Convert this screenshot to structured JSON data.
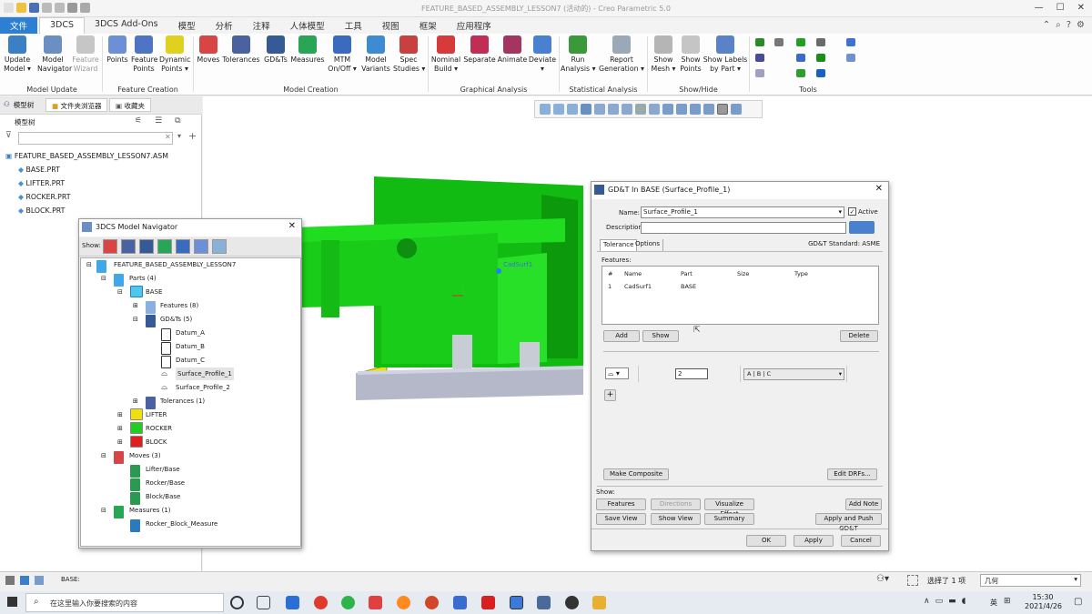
{
  "window": {
    "title": "FEATURE_BASED_ASSEMBLY_LESSON7 (活动的) - Creo Parametric 5.0"
  },
  "tabs": [
    "文件",
    "3DCS",
    "3DCS Add-Ons",
    "模型",
    "分析",
    "注释",
    "人体模型",
    "工具",
    "视图",
    "框架",
    "应用程序"
  ],
  "ribbon": {
    "update_model": "Update\nModel ▾",
    "model_navigator": "Model\nNavigator",
    "feature_wizard": "Feature\nWizard",
    "points": "Points",
    "feature_points": "Feature\nPoints",
    "dynamic_points": "Dynamic\nPoints ▾",
    "moves": "Moves",
    "tolerances": "Tolerances",
    "gdts": "GD&Ts",
    "measures": "Measures",
    "mtm": "MTM\nOn/Off ▾",
    "model_variants": "Model\nVariants",
    "spec_studies": "Spec\nStudies ▾",
    "nominal_build": "Nominal\nBuild ▾",
    "separate": "Separate",
    "animate": "Animate",
    "deviate": "Deviate\n▾",
    "run_analysis": "Run\nAnalysis ▾",
    "report_generation": "Report\nGeneration ▾",
    "show_mesh": "Show\nMesh ▾",
    "show_points": "Show\nPoints",
    "show_labels": "Show Labels\nby Part ▾",
    "groups": [
      "Model Update",
      "Feature Creation",
      "Model Creation",
      "Graphical Analysis",
      "Statistical Analysis",
      "Show/Hide",
      "Tools"
    ]
  },
  "left_panel": {
    "tabs": [
      "模型树",
      "文件夹浏览器",
      "收藏夹"
    ],
    "title": "模型树",
    "root": "FEATURE_BASED_ASSEMBLY_LESSON7.ASM",
    "items": [
      "BASE.PRT",
      "LIFTER.PRT",
      "ROCKER.PRT",
      "BLOCK.PRT"
    ]
  },
  "navigator": {
    "title": "3DCS Model Navigator",
    "show_label": "Show:",
    "root": "FEATURE_BASED_ASSEMBLY_LESSON7",
    "parts": "Parts (4)",
    "base": "BASE",
    "features": "Features (8)",
    "gdts": "GD&Ts (5)",
    "gdt_items": [
      "Datum_A",
      "Datum_B",
      "Datum_C",
      "Surface_Profile_1",
      "Surface_Profile_2"
    ],
    "tolerances": "Tolerances (1)",
    "lifter": "LIFTER",
    "rocker": "ROCKER",
    "block": "BLOCK",
    "moves": "Moves (3)",
    "move_items": [
      "Lifter/Base",
      "Rocker/Base",
      "Block/Base"
    ],
    "measures": "Measures (1)",
    "measure_items": [
      "Rocker_Block_Measure"
    ]
  },
  "viewport": {
    "label": "CadSurf1"
  },
  "gdt_dialog": {
    "title": "GD&T In BASE (Surface_Profile_1)",
    "name_label": "Name:",
    "name_value": "Surface_Profile_1",
    "active_label": "Active",
    "description_label": "Description:",
    "tabs": [
      "Tolerance",
      "Options"
    ],
    "standard": "GD&T Standard: ASME",
    "features_label": "Features:",
    "columns": [
      "#",
      "Name",
      "Part",
      "Size",
      "Type"
    ],
    "rows": [
      [
        "1",
        "CadSurf1",
        "BASE",
        "",
        ""
      ]
    ],
    "add": "Add",
    "show": "Show",
    "delete": "Delete",
    "tolerance_value": "2",
    "drf_value": "A | B | C",
    "plus": "+",
    "make_composite": "Make Composite",
    "edit_drfs": "Edit DRFs...",
    "show_label": "Show:",
    "features_btn": "Features",
    "directions_btn": "Directions",
    "visualize_btn": "Visualize Effect",
    "add_note_btn": "Add Note",
    "save_view_btn": "Save View",
    "show_view_btn": "Show View",
    "summary_btn": "Summary",
    "apply_push_btn": "Apply and Push GD&T",
    "ok": "OK",
    "apply": "Apply",
    "cancel": "Cancel"
  },
  "status": {
    "text": "BASE:",
    "selected": "选择了 1 项",
    "filter": "几何"
  },
  "taskbar": {
    "search_placeholder": "在这里输入你要搜索的内容",
    "ime": "英",
    "time": "15:30",
    "date": "2021/4/26"
  },
  "colors": {
    "accent": "#2d7fd3",
    "green_part": "#22cc22",
    "yellow_part": "#f0e010",
    "base_part": "#b4b8c8"
  }
}
